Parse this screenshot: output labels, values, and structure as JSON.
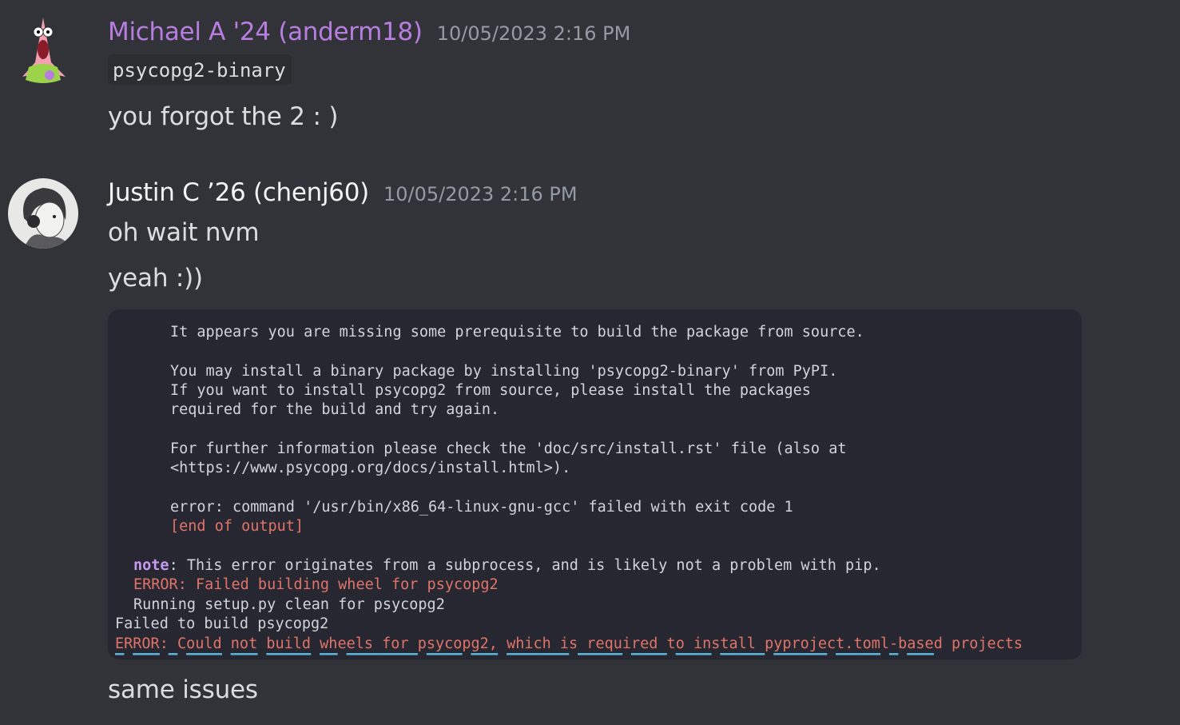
{
  "messages": [
    {
      "username": "Michael A '24 (anderm18)",
      "username_color": "#b77ee0",
      "timestamp": "10/05/2023 2:16 PM",
      "avatar_icon": "patrick-star-avatar",
      "code": "psycopg2-binary",
      "text": "you forgot the 2 : )"
    },
    {
      "username": "Justin C ’26 (chenj60)",
      "username_color": "#f2f3f5",
      "timestamp": "10/05/2023 2:16 PM",
      "avatar_icon": "anime-character-avatar",
      "lines": [
        "oh wait nvm",
        "yeah :))"
      ],
      "after_attachment": "same issues"
    }
  ],
  "terminal": {
    "lines": [
      "It appears you are missing some prerequisite to build the package from source.",
      "You may install a binary package by installing 'psycopg2-binary' from PyPI.",
      "If you want to install psycopg2 from source, please install the packages",
      "required for the build and try again.",
      "For further information please check the 'doc/src/install.rst' file (also at",
      "<https://www.psycopg.org/docs/install.html>).",
      "error: command '/usr/bin/x86_64-linux-gnu-gcc' failed with exit code 1",
      "[end of output]",
      "note",
      ": This error originates from a subprocess, and is likely not a problem with pip.",
      "ERROR: Failed building wheel for psycopg2",
      "Running setup.py clean for psycopg2",
      "Failed to build psycopg2",
      "ERROR: Could not build wheels for psycopg2, which is required to install pyproject.toml-based projects"
    ],
    "colors": {
      "error": "#e1746a",
      "note": "#c79bf2",
      "text": "#d2d4dc",
      "bg": "#262730"
    }
  }
}
